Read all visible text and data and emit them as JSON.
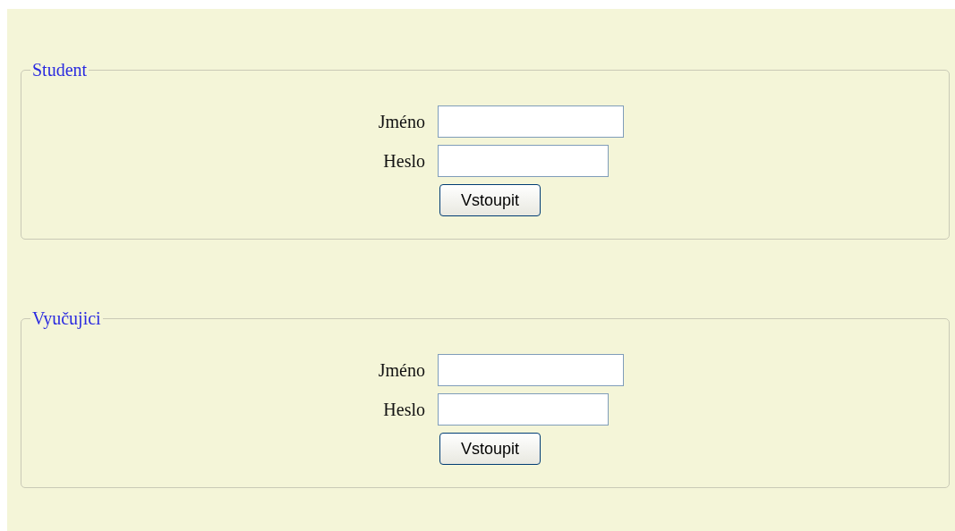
{
  "sections": [
    {
      "legend": "Student",
      "fields": [
        {
          "label": "Jméno",
          "kind": "text"
        },
        {
          "label": "Heslo",
          "kind": "password"
        }
      ],
      "button": "Vstoupit"
    },
    {
      "legend": "Vyučujici",
      "fields": [
        {
          "label": "Jméno",
          "kind": "text"
        },
        {
          "label": "Heslo",
          "kind": "password"
        }
      ],
      "button": "Vstoupit"
    }
  ]
}
